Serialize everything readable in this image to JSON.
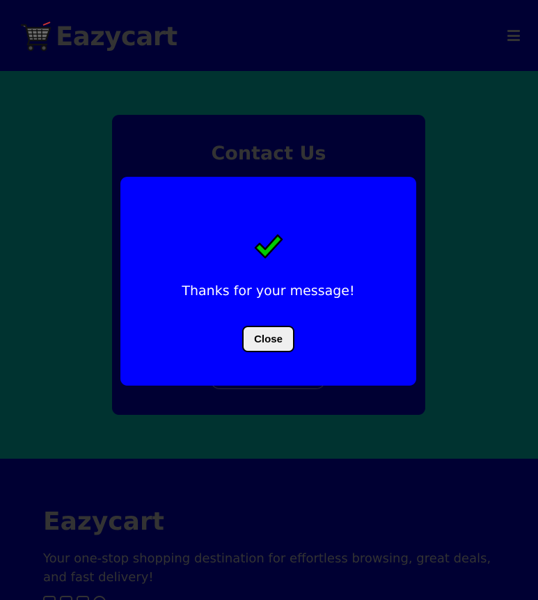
{
  "header": {
    "brand": "Eazycart",
    "cart_icon": "shopping-cart-icon",
    "menu_icon": "hamburger-menu-icon"
  },
  "contact": {
    "title": "Contact Us"
  },
  "modal": {
    "icon": "check-mark-icon",
    "message": "Thanks for your message!",
    "close_label": "Close"
  },
  "footer": {
    "brand": "Eazycart",
    "tagline": "Your one-stop shopping destination for effortless browsing, great deals, and fast delivery!",
    "social_icons": [
      "instagram-icon",
      "twitter-icon",
      "youtube-icon",
      "pinterest-icon"
    ]
  },
  "colors": {
    "header_bg": "#000033",
    "main_bg": "#003330",
    "modal_bg": "#0000ff",
    "muted_text": "#333333",
    "check_green": "#00cc00"
  }
}
